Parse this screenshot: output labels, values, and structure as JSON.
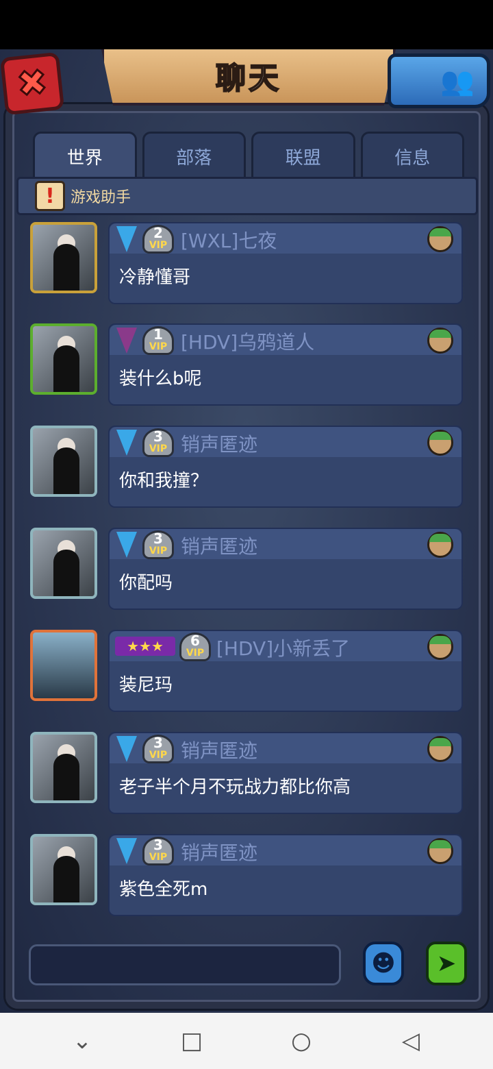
{
  "header": {
    "title": "聊天"
  },
  "tabs": [
    {
      "label": "世界",
      "active": true
    },
    {
      "label": "部落",
      "active": false
    },
    {
      "label": "联盟",
      "active": false
    },
    {
      "label": "信息",
      "active": false
    }
  ],
  "helper": {
    "label": "游戏助手"
  },
  "messages": [
    {
      "vip": "2",
      "name": "[WXL]七夜",
      "text": "冷静懂哥",
      "badge": "shield-blue"
    },
    {
      "vip": "1",
      "name": "[HDV]乌鸦道人",
      "text": "装什么b呢",
      "badge": "shield-purple"
    },
    {
      "vip": "3",
      "name": "销声匿迹",
      "text": "你和我撞？",
      "badge": "shield-blue"
    },
    {
      "vip": "3",
      "name": "销声匿迹",
      "text": "你配吗",
      "badge": "shield-blue"
    },
    {
      "vip": "6",
      "name": "[HDV]小新丢了",
      "text": "装尼玛",
      "badge": "stars"
    },
    {
      "vip": "3",
      "name": "销声匿迹",
      "text": "老子半个月不玩战力都比你高",
      "badge": "shield-blue"
    },
    {
      "vip": "3",
      "name": "销声匿迹",
      "text": "紫色全死m",
      "badge": "shield-blue"
    }
  ],
  "vip_text": "VIP",
  "colors": {
    "name": "#7f93c4",
    "bubble": "#34456c",
    "accent_gold": "#e9c089"
  }
}
